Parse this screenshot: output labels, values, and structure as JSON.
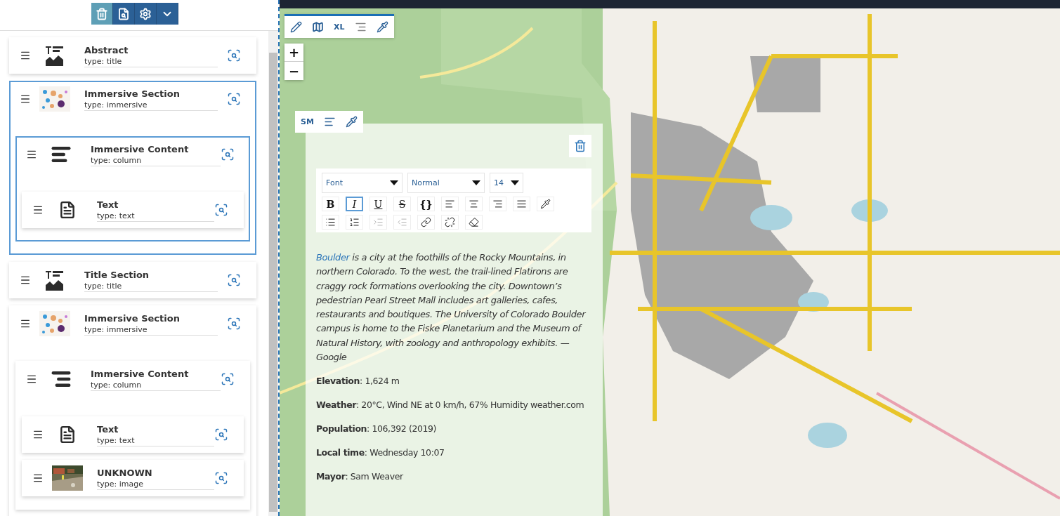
{
  "toolbar": {
    "buttons": [
      {
        "kind": "delete",
        "disabled": true
      },
      {
        "kind": "preview",
        "disabled": false
      },
      {
        "kind": "settings",
        "disabled": false
      },
      {
        "kind": "collapse",
        "disabled": false
      }
    ]
  },
  "tree": [
    {
      "title": "Abstract",
      "type": "type: title",
      "kind": "title",
      "selected": false
    },
    {
      "title": "Immersive Section",
      "type": "type: immersive",
      "kind": "dot-map",
      "selected": true,
      "children": [
        {
          "title": "Immersive Content",
          "type": "type: column",
          "kind": "align-left",
          "selected": true,
          "children": [
            {
              "title": "Text",
              "type": "type: text",
              "kind": "document",
              "selected": false
            }
          ]
        }
      ]
    },
    {
      "title": "Title Section",
      "type": "type: title",
      "kind": "title",
      "selected": false
    },
    {
      "title": "Immersive Section",
      "type": "type: immersive",
      "kind": "dot-map",
      "selected": false,
      "children": [
        {
          "title": "Immersive Content",
          "type": "type: column",
          "kind": "align-right",
          "selected": false,
          "children": [
            {
              "title": "Text",
              "type": "type: text",
              "kind": "document",
              "selected": false
            },
            {
              "title": "UNKNOWN",
              "type": "type: image",
              "selected": false
            }
          ]
        }
      ]
    }
  ],
  "map": {
    "toolbar": {
      "size_label": "XL"
    },
    "zoom": {
      "in": "+",
      "out": "−"
    }
  },
  "card": {
    "size_label": "SM",
    "editor": {
      "dropdowns": [
        {
          "value": "Font"
        },
        {
          "value": "Normal"
        },
        {
          "value": "14"
        }
      ],
      "rows": [
        [
          {
            "kind": "bold",
            "label": "B",
            "selected": false,
            "disabled": false
          },
          {
            "kind": "italic",
            "label": "I",
            "selected": true,
            "disabled": false
          },
          {
            "kind": "underline",
            "label": "U",
            "selected": false,
            "disabled": false
          },
          {
            "kind": "strike",
            "label": "S",
            "selected": false,
            "disabled": false
          },
          {
            "kind": "code",
            "label": "{}",
            "selected": false,
            "disabled": false
          },
          {
            "kind": "align-left",
            "selected": false,
            "disabled": false
          },
          {
            "kind": "align-center",
            "selected": false,
            "disabled": false
          },
          {
            "kind": "align-right",
            "selected": false,
            "disabled": false
          },
          {
            "kind": "justify",
            "selected": false,
            "disabled": false
          },
          {
            "kind": "color",
            "selected": false,
            "disabled": false
          }
        ],
        [
          {
            "kind": "bullet-list",
            "selected": false,
            "disabled": false
          },
          {
            "kind": "numbered-list",
            "selected": false,
            "disabled": false
          },
          {
            "kind": "indent",
            "selected": false,
            "disabled": true
          },
          {
            "kind": "outdent",
            "selected": false,
            "disabled": true
          },
          {
            "kind": "link",
            "selected": false,
            "disabled": false
          },
          {
            "kind": "unlink",
            "selected": false,
            "disabled": false
          },
          {
            "kind": "eraser",
            "selected": false,
            "disabled": false
          }
        ]
      ]
    },
    "description": {
      "link": "Boulder",
      "text": " is a city at the foothills of the Rocky Mountains, in northern Colorado. To the west, the trail-lined Flatirons are craggy rock formations overlooking the city. Downtown’s pedestrian Pearl Street Mall includes art galleries, cafes, restaurants and boutiques. The University of Colorado Boulder campus is home to the Fiske Planetarium and the Museum of Natural History, with zoology and anthropology exhibits. — Google"
    },
    "facts": [
      "**Elevation**: 1,624 m",
      "**Weather**: 20°C, Wind NE at 0 km/h, 67% Humidity weather.com",
      "**Population**: 106,392 (2019)",
      "**Local time**: Wednesday 10:07",
      "**Mayor**: Sam Weaver"
    ]
  }
}
